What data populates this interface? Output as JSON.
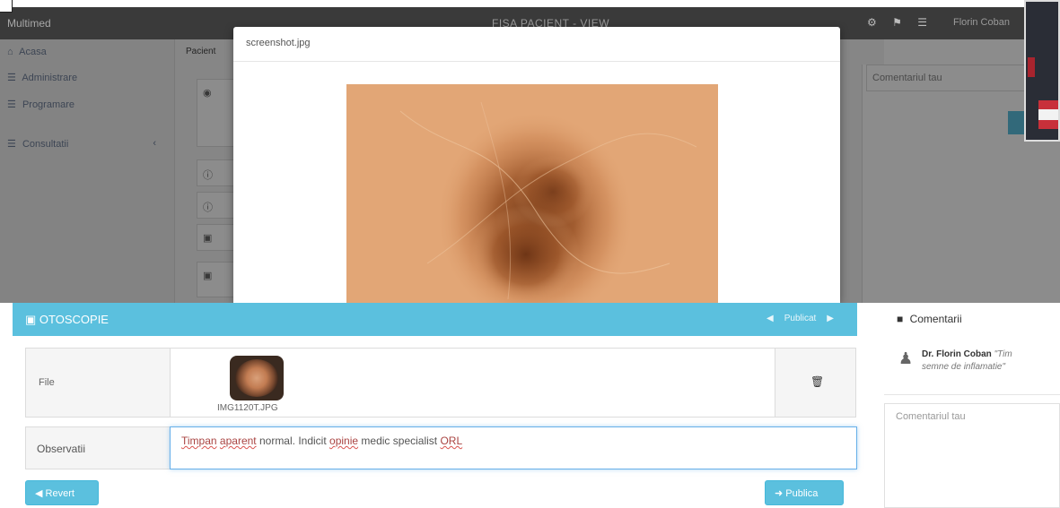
{
  "background_app": {
    "brand": "Multimed",
    "title": "FISA PACIENT - VIEW",
    "user_name": "Florin Coban",
    "sidebar": {
      "items": [
        {
          "icon": "home-icon",
          "label": "Acasa"
        },
        {
          "icon": "list-icon",
          "label": "Administrare"
        },
        {
          "icon": "list-icon",
          "label": "Programare"
        },
        {
          "icon": "list-icon",
          "label": "Consultatii"
        }
      ]
    },
    "main_label": "Pacient",
    "comment_placeholder": "Comentariul tau"
  },
  "modal": {
    "title": "screenshot.jpg"
  },
  "otoscopie": {
    "title": "OTOSCOPIE",
    "header_action": "Publicat",
    "file_label": "File",
    "file_name": "IMG1120T.JPG",
    "observatii_label": "Observatii",
    "observatii_words": [
      {
        "text": "Timpan",
        "flag": true
      },
      {
        "text": "aparent",
        "flag": true
      },
      {
        "text": "normal.",
        "flag": false
      },
      {
        "text": "Indicit",
        "flag": false
      },
      {
        "text": "opinie",
        "flag": true
      },
      {
        "text": "medic",
        "flag": false
      },
      {
        "text": "specialist",
        "flag": false
      },
      {
        "text": "ORL",
        "flag": true
      }
    ],
    "revert_label": "Revert",
    "publica_label": "Publica"
  },
  "comments": {
    "title": "Comentarii",
    "items": [
      {
        "author": "Dr. Florin Coban",
        "text_line1": "\"Tim",
        "text_line2": "semne de inflamatie\""
      }
    ],
    "input_placeholder": "Comentariul tau"
  },
  "colors": {
    "accent": "#5bc0de",
    "navbar": "#3a3a3a",
    "spell_error": "#d9534f"
  }
}
